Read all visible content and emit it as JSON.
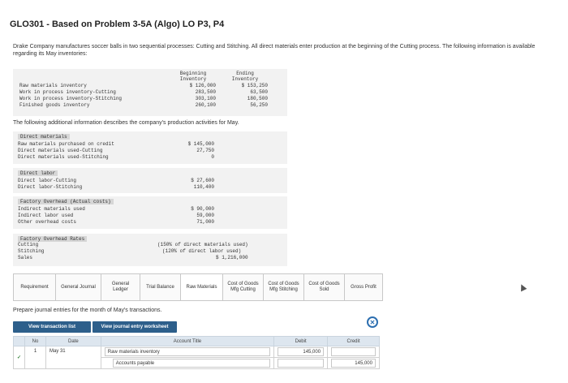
{
  "title": "GLO301 - Based on Problem 3-5A (Algo) LO P3, P4",
  "intro": "Drake Company manufactures soccer balls in two sequential processes: Cutting and Stitching. All direct materials enter production at the beginning of the Cutting process. The following information is available regarding its May inventories:",
  "inventories": {
    "headers": {
      "beginning": "Beginning Inventory",
      "ending": "Ending Inventory"
    },
    "rows": [
      {
        "label": "Raw materials inventory",
        "beginning": "$ 126,000",
        "ending": "$ 153,250"
      },
      {
        "label": "Work in process inventory-Cutting",
        "beginning": "283,500",
        "ending": "63,500"
      },
      {
        "label": "Work in process inventory-Stitching",
        "beginning": "303,100",
        "ending": "180,500"
      },
      {
        "label": "Finished goods inventory",
        "beginning": "260,100",
        "ending": "56,250"
      }
    ]
  },
  "additional_info": "The following additional information describes the company's production activities for May.",
  "direct_materials": {
    "header": "Direct materials",
    "rows": [
      {
        "label": "Raw materials purchased on credit",
        "value": "$ 145,000"
      },
      {
        "label": "Direct materials used-Cutting",
        "value": "27,750"
      },
      {
        "label": "Direct materials used-Stitching",
        "value": "0"
      }
    ]
  },
  "direct_labor": {
    "header": "Direct labor",
    "rows": [
      {
        "label": "Direct labor-Cutting",
        "value": "$ 27,600"
      },
      {
        "label": "Direct labor-Stitching",
        "value": "110,400"
      }
    ]
  },
  "overhead": {
    "header": "Factory Overhead (Actual costs)",
    "rows": [
      {
        "label": "Indirect materials used",
        "value": "$ 90,000"
      },
      {
        "label": "Indirect labor used",
        "value": "59,000"
      },
      {
        "label": "Other overhead costs",
        "value": "71,000"
      }
    ]
  },
  "rates": {
    "header": "Factory Overhead Rates",
    "rows": [
      {
        "label": "Cutting",
        "text": "(150% of direct materials used)"
      },
      {
        "label": "Stitching",
        "text": "(120% of direct labor used)"
      },
      {
        "label": "Sales",
        "text": "$ 1,216,000"
      }
    ]
  },
  "tabs": [
    "Requirement",
    "General Journal",
    "General Ledger",
    "Trial Balance",
    "Raw Materials",
    "Cost of Goods Mfg Cutting",
    "Cost of Goods Mfg Stitching",
    "Cost of Goods Sold",
    "Gross Profit"
  ],
  "prepare_text": "Prepare journal entries for the month of May's transactions.",
  "buttons": {
    "view_transaction": "View transaction list",
    "view_journal": "View journal entry worksheet"
  },
  "journal": {
    "headers": {
      "no": "No",
      "date": "Date",
      "account": "Account Title",
      "debit": "Debit",
      "credit": "Credit"
    },
    "entry": {
      "no": "1",
      "date": "May 31",
      "debit_account": "Raw materials inventory",
      "credit_account": "Accounts payable",
      "debit": "145,000",
      "credit": "145,000"
    }
  },
  "icons": {
    "close": "close-circle-icon",
    "check": "check-icon",
    "cursor": "cursor-icon"
  },
  "colors": {
    "button": "#2d5f8b",
    "table_header": "#dde6ef",
    "close_icon": "#2d6fb0"
  }
}
